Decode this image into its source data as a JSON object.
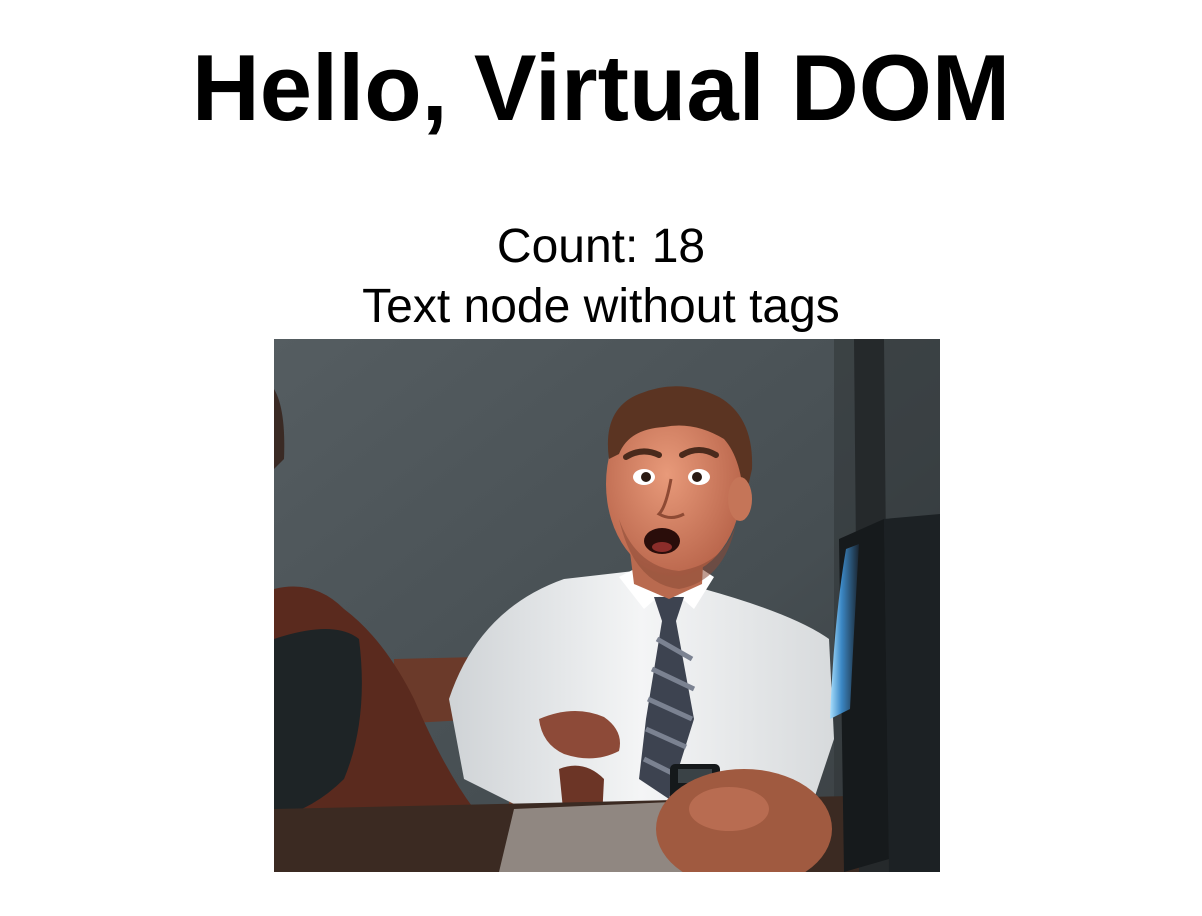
{
  "heading": "Hello, Virtual DOM",
  "counter": {
    "label": "Count: ",
    "value": "18"
  },
  "text_node": "Text node without tags",
  "image": {
    "description_icon": "reaction-gif-image"
  },
  "colors": {
    "background": "#ffffff",
    "text": "#000000",
    "wall": "#4b5255"
  }
}
